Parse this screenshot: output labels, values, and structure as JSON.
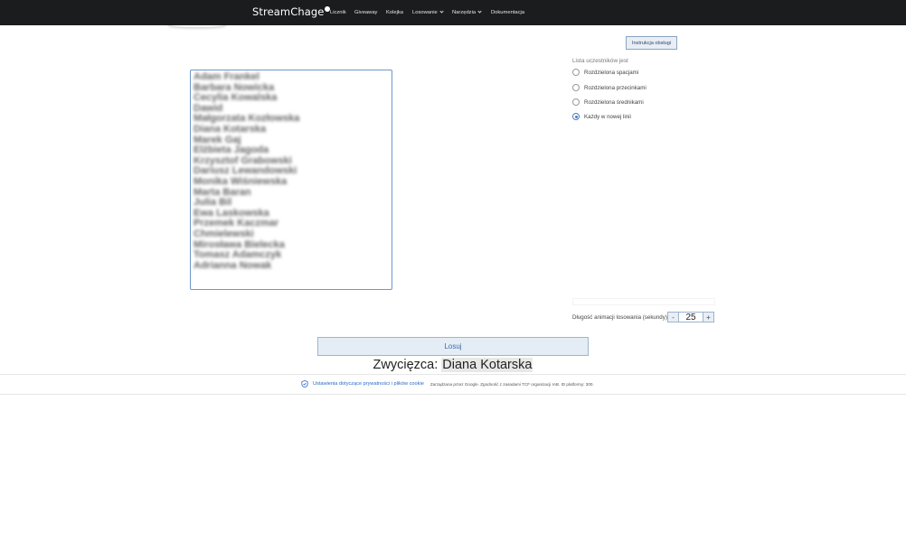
{
  "header": {
    "logo": "StreamChage",
    "nav": [
      {
        "label": "Licznik",
        "dropdown": false
      },
      {
        "label": "Giveaway",
        "dropdown": false
      },
      {
        "label": "Kolejka",
        "dropdown": false
      },
      {
        "label": "Losowanie",
        "dropdown": true
      },
      {
        "label": "Narzędzia",
        "dropdown": true
      },
      {
        "label": "Dokumentacja",
        "dropdown": false
      }
    ]
  },
  "help_button": "Instrukcja obsługi",
  "participants": {
    "list_label": "Lista uczestników jest",
    "options": [
      {
        "label": "Rozdzielona spacjami",
        "checked": false
      },
      {
        "label": "Rozdzielona przecinkami",
        "checked": false
      },
      {
        "label": "Rozdzielona średnikami",
        "checked": false
      },
      {
        "label": "Każdy w nowej linii",
        "checked": true
      }
    ],
    "names": [
      "Adam Frankel",
      "Barbara Nowicka",
      "Cecylia Kowalska",
      "Dawid",
      "Małgorzata Kozłowska",
      "Diana Kotarska",
      "Marek Gaj",
      "Elżbieta Jagoda",
      "Krzysztof Grabowski",
      "Dariusz Lewandowski",
      "Monika Wiśniewska",
      "Marta Baran",
      "Julia Bil",
      "Ewa Laskowska",
      "Przemek Kaczmar",
      "Chmielewski",
      "Mirosława Bielecka",
      "Tomasz Adamczyk",
      "Adrianna Nowak"
    ]
  },
  "animation": {
    "label": "Długość animacji losowania (sekundy)",
    "minus": "-",
    "value": "25",
    "plus": "+"
  },
  "draw_button": "Losuj",
  "winner": {
    "label": "Zwycięzca:",
    "name": "Diana Kotarska"
  },
  "footer": {
    "privacy_link": "Ustawienia dotyczące prywatności i plików cookie",
    "note": "Zarządzana przez Google. Zgodność z zasadami TCF organizacji IAB. ID platformy: 300."
  },
  "colors": {
    "topbar": "#1b1c1e",
    "accent": "#4a7fc1",
    "link": "#2b6bc6"
  }
}
